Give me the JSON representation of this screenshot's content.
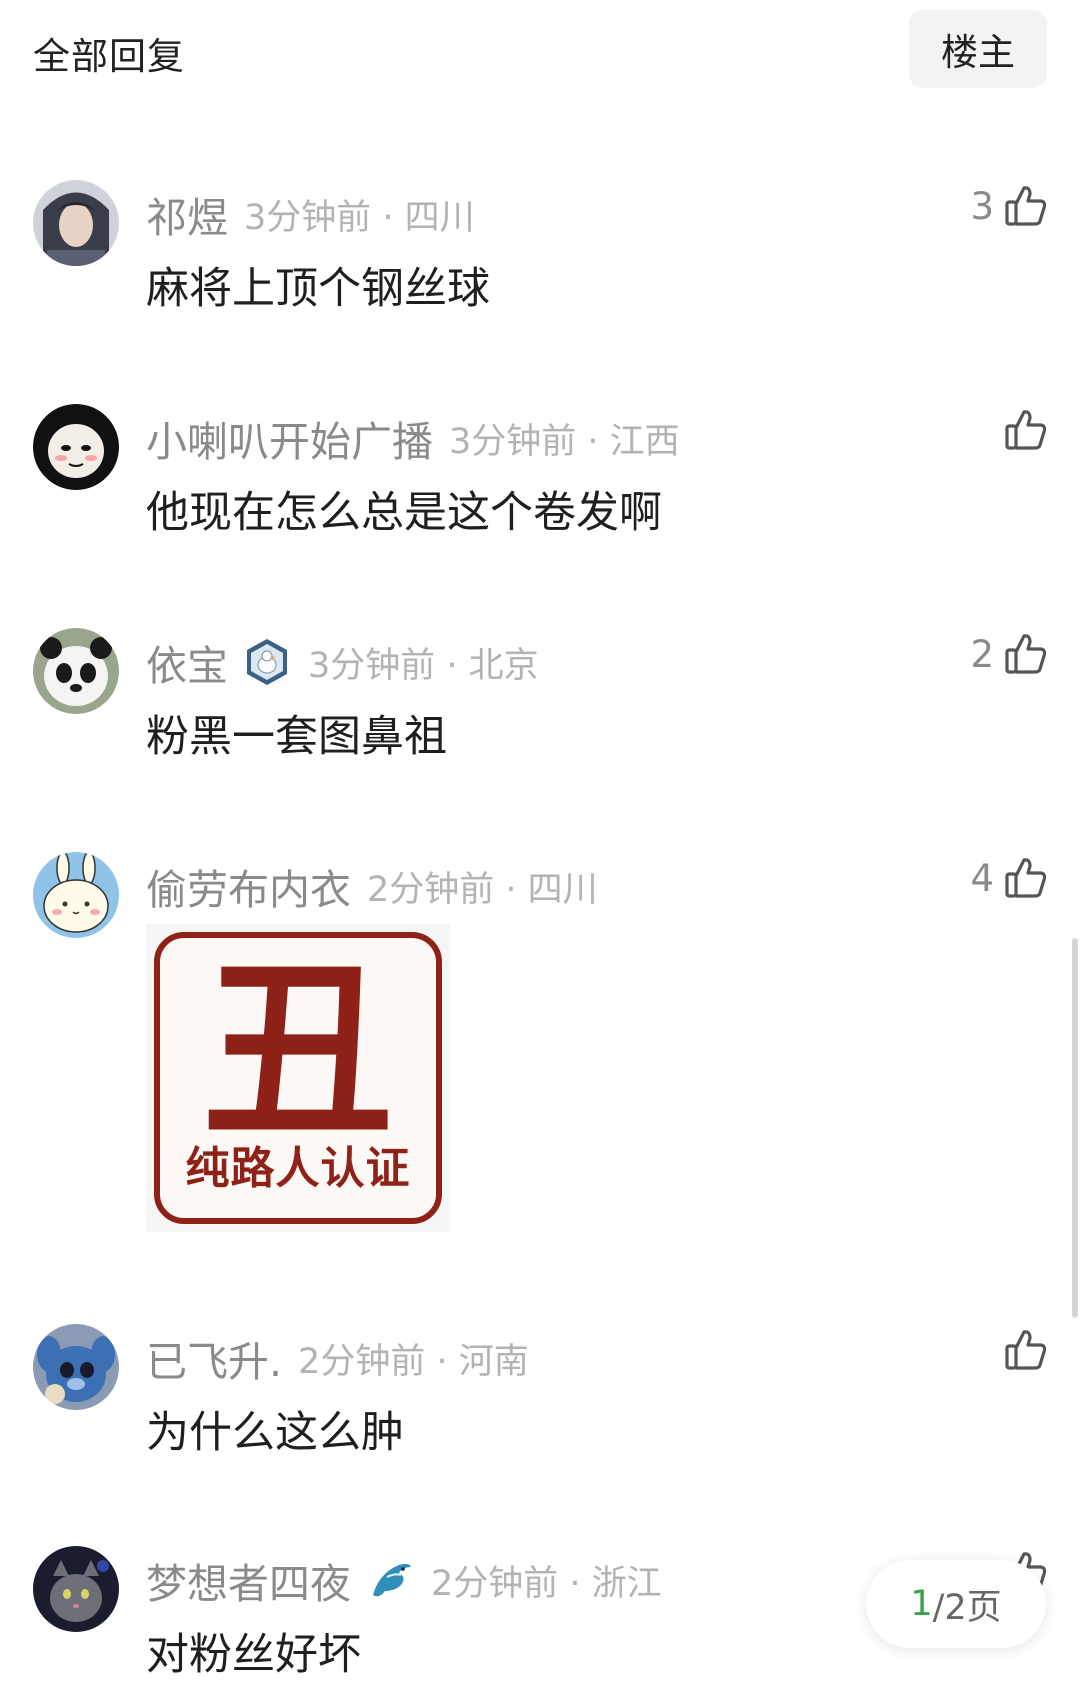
{
  "header": {
    "title": "全部回复",
    "filter_label": "楼主"
  },
  "comments": [
    {
      "username": "祁煜",
      "time_location": "3分钟前 · 四川",
      "content": "麻将上顶个钢丝球",
      "likes": "3"
    },
    {
      "username": "小喇叭开始广播",
      "time_location": "3分钟前 · 江西",
      "content": "他现在怎么总是这个卷发啊",
      "likes": ""
    },
    {
      "username": "依宝",
      "time_location": "3分钟前 · 北京",
      "content": "粉黑一套图鼻祖",
      "likes": "2"
    },
    {
      "username": "偷劳布内衣",
      "time_location": "2分钟前 · 四川",
      "sticker": {
        "big_char": "丑",
        "caption": "纯路人认证"
      },
      "likes": "4"
    },
    {
      "username": "已飞升.",
      "time_location": "2分钟前 · 河南",
      "content": "为什么这么肿",
      "likes": ""
    },
    {
      "username": "梦想者四夜",
      "time_location": "2分钟前 · 浙江",
      "content": "对粉丝好坏",
      "likes": ""
    }
  ],
  "pager": {
    "current": "1",
    "total": "/2页"
  },
  "colors": {
    "page_current": "#3aa14c",
    "sticker_red": "#8e2219",
    "meta_gray": "#b3b3b3"
  }
}
